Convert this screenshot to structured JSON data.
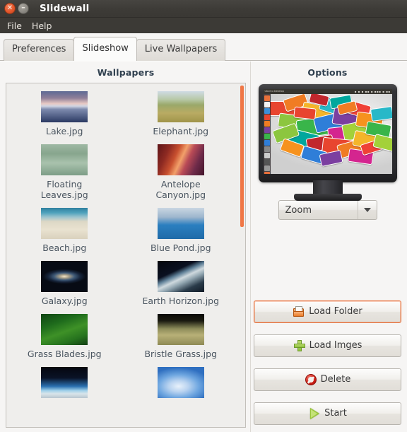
{
  "window": {
    "title": "Slidewall",
    "close_icon": "close-icon",
    "minimize_icon": "minimize-icon",
    "close_glyph": "✕",
    "minimize_glyph": "–"
  },
  "menubar": {
    "items": [
      {
        "label": "File"
      },
      {
        "label": "Help"
      }
    ]
  },
  "tabs": [
    {
      "label": "Preferences",
      "active": false
    },
    {
      "label": "Slideshow",
      "active": true
    },
    {
      "label": "Live Wallpapers",
      "active": false
    }
  ],
  "left_panel": {
    "title": "Wallpapers",
    "scrollbar_color": "#f07746",
    "items": [
      {
        "label": "Lake.jpg",
        "thumb": "lake"
      },
      {
        "label": "Elephant.jpg",
        "thumb": "elephant"
      },
      {
        "label": "Floating Leaves.jpg",
        "thumb": "leaves"
      },
      {
        "label": "Antelope Canyon.jpg",
        "thumb": "canyon"
      },
      {
        "label": "Beach.jpg",
        "thumb": "beach"
      },
      {
        "label": "Blue Pond.jpg",
        "thumb": "pond"
      },
      {
        "label": "Galaxy.jpg",
        "thumb": "galaxy"
      },
      {
        "label": "Earth Horizon.jpg",
        "thumb": "horizon"
      },
      {
        "label": "Grass Blades.jpg",
        "thumb": "grassblades"
      },
      {
        "label": "Bristle Grass.jpg",
        "thumb": "bristle"
      },
      {
        "label": "",
        "thumb": "earthlimb"
      },
      {
        "label": "",
        "thumb": "sky"
      }
    ]
  },
  "right_panel": {
    "title": "Options",
    "preview": {
      "name": "monitor-preview",
      "panel_title": "Ubuntu Desktop"
    },
    "scale_mode": {
      "selected": "Zoom",
      "arrow_icon": "chevron-down-icon"
    },
    "buttons": [
      {
        "label": "Load Folder",
        "icon": "folder-icon",
        "focused": true
      },
      {
        "label": "Load Imges",
        "icon": "plus-icon",
        "focused": false
      },
      {
        "label": "Delete",
        "icon": "deny-icon",
        "focused": false
      },
      {
        "label": "Start",
        "icon": "play-icon",
        "focused": false
      }
    ]
  },
  "colors": {
    "titlebar": "#3d3b37",
    "accent_orange": "#e8703a",
    "scrollbar": "#f07746",
    "pane_title": "#30404f",
    "label_text": "#4a5560"
  }
}
